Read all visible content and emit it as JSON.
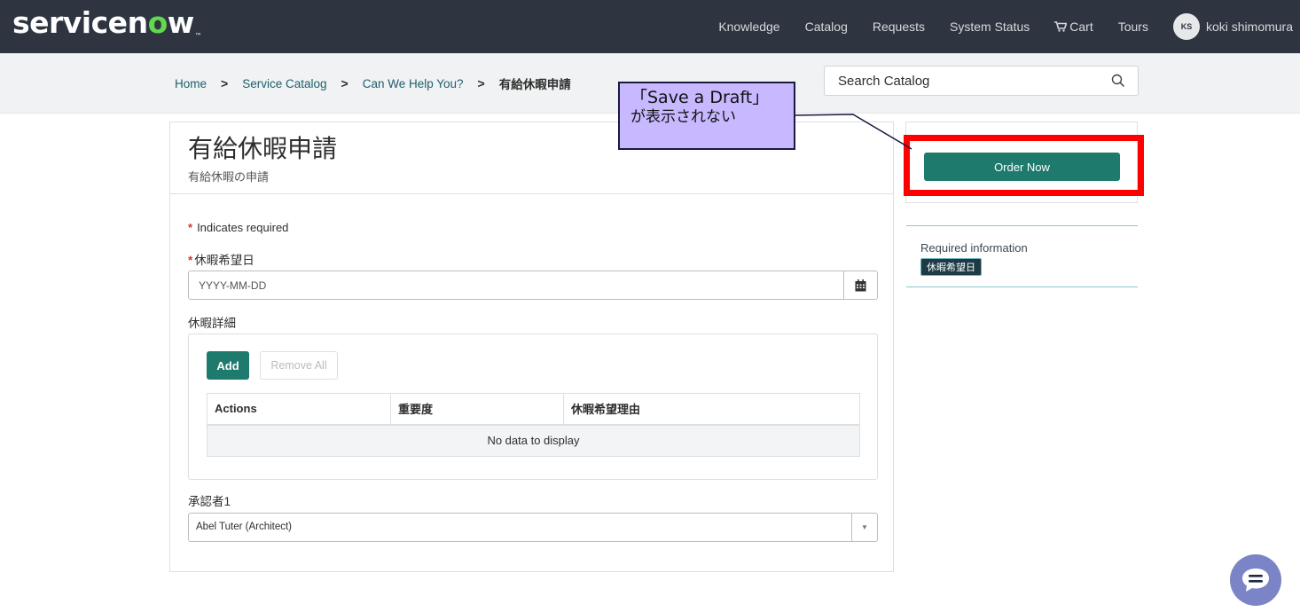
{
  "header": {
    "logo_text_pre": "servicen",
    "logo_text_o": "o",
    "logo_text_post": "w",
    "logo_tm": "™",
    "nav": [
      "Knowledge",
      "Catalog",
      "Requests",
      "System Status",
      "Cart",
      "Tours"
    ],
    "user_initials": "KS",
    "user_name": "koki shimomura"
  },
  "breadcrumb": {
    "items": [
      "Home",
      "Service Catalog",
      "Can We Help You?"
    ],
    "current": "有給休暇申請"
  },
  "search": {
    "placeholder": "Search Catalog"
  },
  "form": {
    "title": "有給休暇申請",
    "subtitle": "有給休暇の申請",
    "required_marker": "*",
    "required_note": "Indicates required",
    "date_label": "休暇希望日",
    "date_placeholder": "YYYY-MM-DD",
    "details_label": "休暇詳細",
    "add_label": "Add",
    "remove_all_label": "Remove All",
    "table_headers": [
      "Actions",
      "重要度",
      "休暇希望理由"
    ],
    "empty_text": "No data to display",
    "approver_label": "承認者1",
    "approver_value": "Abel Tuter (Architect)",
    "approver_arrow": "▼"
  },
  "sidebar": {
    "order_label": "Order Now",
    "required_info_title": "Required information",
    "required_badge": "休暇希望日"
  },
  "annotation": {
    "line1": "「Save a Draft」",
    "line2": "が表示されない"
  },
  "colors": {
    "topbar": "#2e3540",
    "accent_green": "#1f7a6e",
    "highlight_red": "#ff0000",
    "callout_fill": "#c8b8ff"
  },
  "icons": [
    "search-icon",
    "calendar-icon",
    "cart-icon",
    "chevron-right-icon",
    "chat-icon"
  ]
}
